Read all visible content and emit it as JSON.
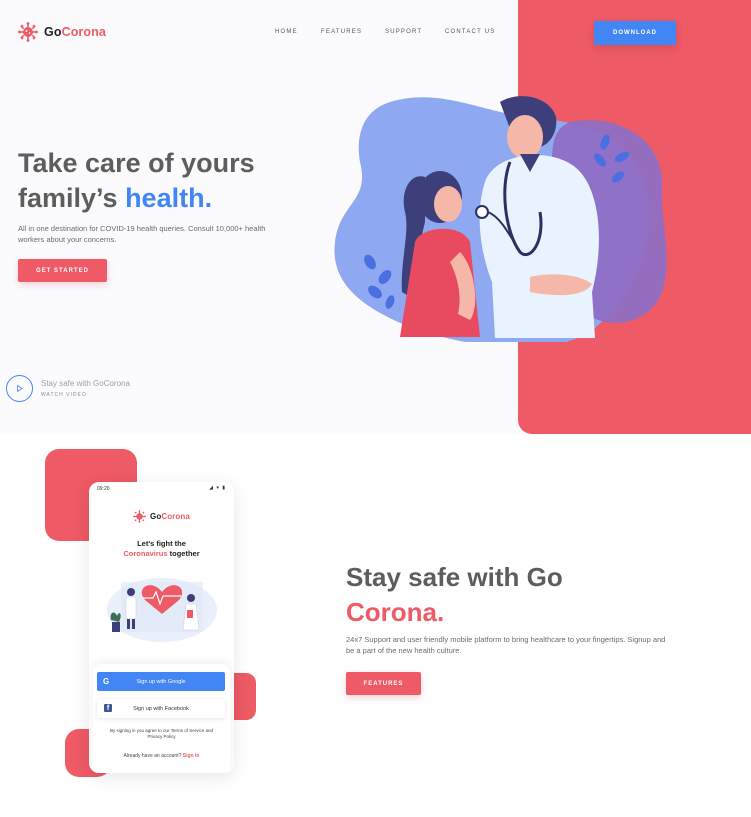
{
  "brand": {
    "name_part1": "Go",
    "name_part2": "Corona",
    "accent_red": "#ee5a66",
    "accent_blue": "#4285f4",
    "logo_icon": "virus-icon"
  },
  "nav": {
    "items": [
      {
        "label": "HOME"
      },
      {
        "label": "FEATURES"
      },
      {
        "label": "SUPPORT"
      },
      {
        "label": "CONTACT US"
      }
    ],
    "download_label": "DOWNLOAD"
  },
  "hero": {
    "title_line1": "Take care of yours",
    "title_line2_prefix": "family’s ",
    "title_line2_highlight": "health.",
    "description": "All in one destination for COVID-19 health queries.  Consult 10,000+ health workers about your concerns.",
    "cta_label": "GET STARTED",
    "watch_title": "Stay safe with GoCorona",
    "watch_sub": "WATCH VIDEO",
    "illustration_icon": "doctor-patient-illustration"
  },
  "phone": {
    "status_time": "09:20",
    "status_icons": "◢ ▾ ▮",
    "brand_part1": "Go",
    "brand_part2": "Corona",
    "headline_line1": "Let's fight the",
    "headline_red": "Coronavirus",
    "headline_rest": " together",
    "google_label": "Sign up with Google",
    "facebook_label": "Sign up with Facebook",
    "terms_text": "By signing in you agree to our Terms of Service and Privacy Policy",
    "signin_prefix": "Already have an account? ",
    "signin_link": "Sign In"
  },
  "section2": {
    "title_line1": "Stay safe with Go",
    "title_line2": "Corona.",
    "description": "24x7 Support and user friendly mobile platform to bring healthcare to your fingertips. Signup and be a part of the new health culture.",
    "cta_label": "FEATURES"
  }
}
